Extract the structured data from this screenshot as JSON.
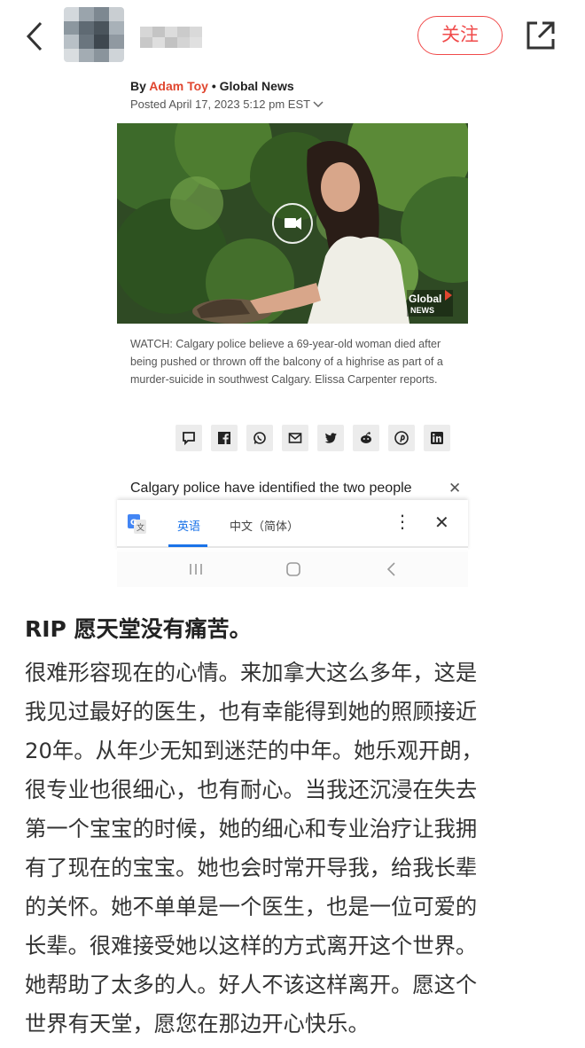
{
  "header": {
    "follow_label": "关注"
  },
  "article": {
    "by_label": "By",
    "author": "Adam Toy",
    "separator": "•",
    "outlet": "Global News",
    "posted": "Posted April 17, 2023 5:12 pm EST",
    "photo_logo_line1": "Global",
    "photo_logo_line2": "NEWS",
    "caption": "WATCH: Calgary police believe a 69-year-old woman died after being pushed or thrown off the balcony of a highrise as part of a murder-suicide in southwest Calgary. Elissa Carpenter reports.",
    "share_icons": [
      "comment-icon",
      "facebook-icon",
      "whatsapp-icon",
      "email-icon",
      "twitter-icon",
      "reddit-icon",
      "pinterest-icon",
      "linkedin-icon"
    ],
    "first_line": "Calgary police have identified the two people"
  },
  "translate": {
    "lang_source": "英语",
    "lang_target": "中文（简体）"
  },
  "post": {
    "title": "RIP 愿天堂没有痛苦。",
    "body": "很难形容现在的心情。来加拿大这么多年，这是\n我见过最好的医生，也有幸能得到她的照顾接近\n20年。从年少无知到迷茫的中年。她乐观开朗，\n很专业也很细心，也有耐心。当我还沉浸在失去\n第一个宝宝的时候，她的细心和专业治疗让我拥\n有了现在的宝宝。她也会时常开导我，给我长辈\n的关怀。她不单单是一个医生，也是一位可爱的\n长辈。很难接受她以这样的方式离开这个世界。\n她帮助了太多的人。好人不该这样离开。愿这个\n世界有天堂，愿您在那边开心快乐。"
  },
  "colors": {
    "follow": "#f04a4a",
    "author": "#e0462f",
    "translate_accent": "#1a73e8"
  }
}
